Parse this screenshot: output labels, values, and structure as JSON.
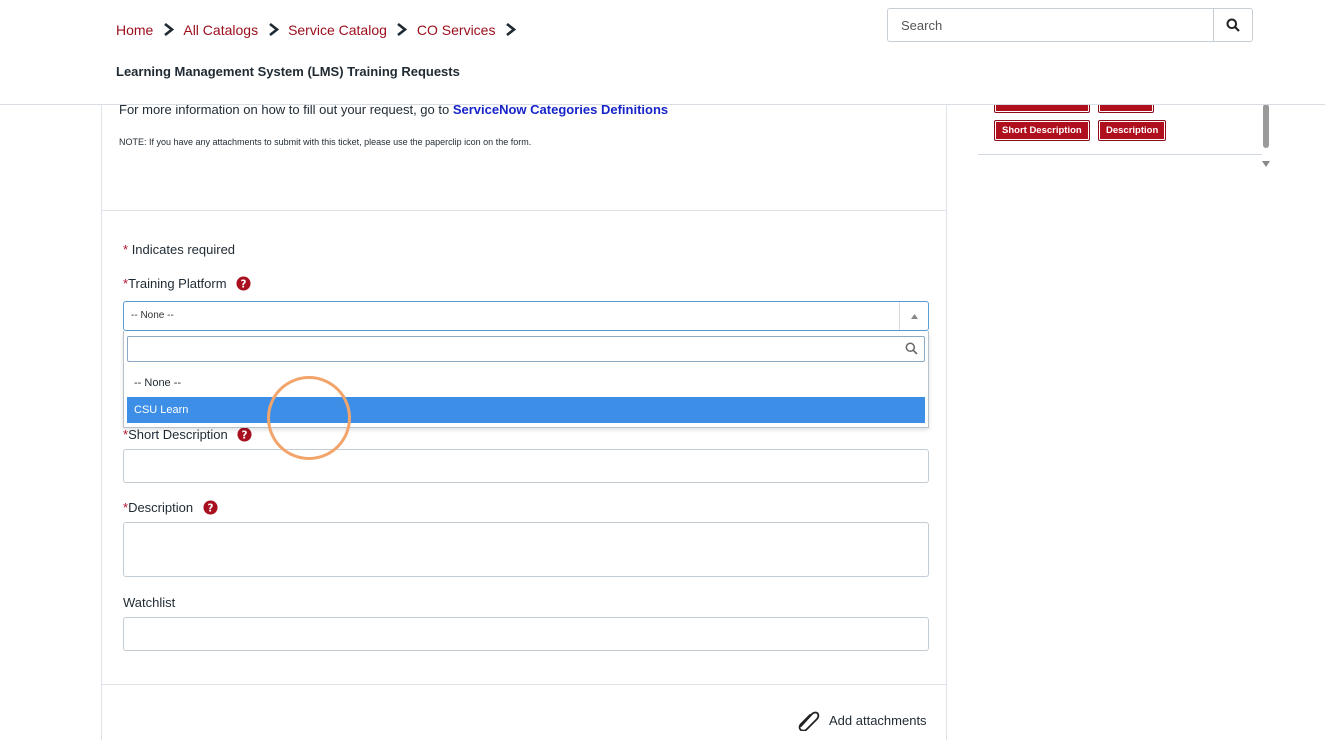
{
  "breadcrumb": {
    "items": [
      "Home",
      "All Catalogs",
      "Service Catalog",
      "CO Services"
    ]
  },
  "header": {
    "page_title": "Learning Management System (LMS) Training Requests",
    "search_placeholder": "Search"
  },
  "intro": {
    "info_text": "For more information on how to fill out your request, go to ",
    "info_link": "ServiceNow Categories Definitions",
    "note": "NOTE: If you have any attachments to submit with this ticket, please use the paperclip icon on the form."
  },
  "form": {
    "required_marker": "*",
    "required_note": "Indicates required",
    "training_platform": {
      "label": "Training Platform",
      "value": "-- None --",
      "options": [
        "-- None --",
        "CSU Learn"
      ],
      "highlighted_option": "CSU Learn"
    },
    "short_description": {
      "label": "Short Description",
      "value": ""
    },
    "description": {
      "label": "Description",
      "value": ""
    },
    "watchlist": {
      "label": "Watchlist",
      "value": ""
    },
    "add_attachments": "Add attachments"
  },
  "sidebar": {
    "tags": [
      "Short Description",
      "Description"
    ]
  },
  "colors": {
    "brand": "#9b0d1b",
    "link": "#1624c8",
    "highlight": "#3d8ee6",
    "tag": "#b00f1d",
    "focus_ring": "#f2a46a"
  }
}
